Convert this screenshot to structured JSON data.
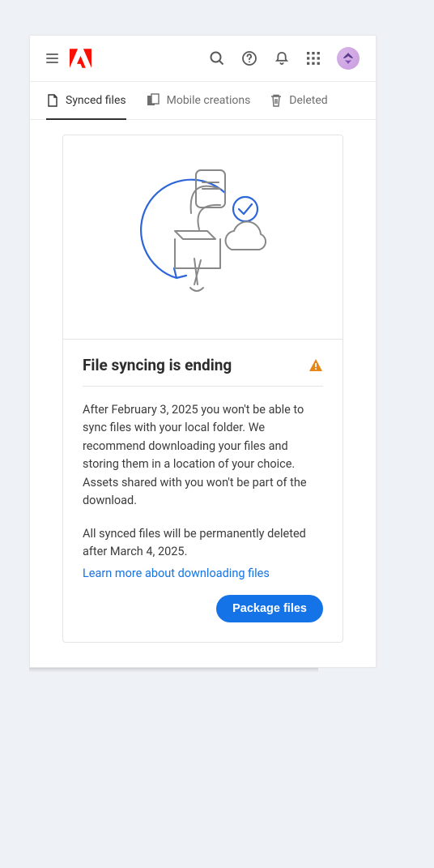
{
  "header": {
    "icons": {
      "menu": "menu",
      "search": "search",
      "help": "help",
      "notification": "notification",
      "apps": "apps"
    }
  },
  "tabs": [
    {
      "label": "Synced files",
      "active": true
    },
    {
      "label": "Mobile creations",
      "active": false
    },
    {
      "label": "Deleted",
      "active": false
    }
  ],
  "card": {
    "title": "File syncing is ending",
    "paragraph1": "After February 3, 2025 you won't be able to sync files with your local folder. We recommend downloading your files and storing them in a location of your choice. Assets shared with you won't be part of the download.",
    "paragraph2": "All synced files will be permanently deleted after March 4, 2025.",
    "link_text": "Learn more about downloading files",
    "button_label": "Package files"
  }
}
